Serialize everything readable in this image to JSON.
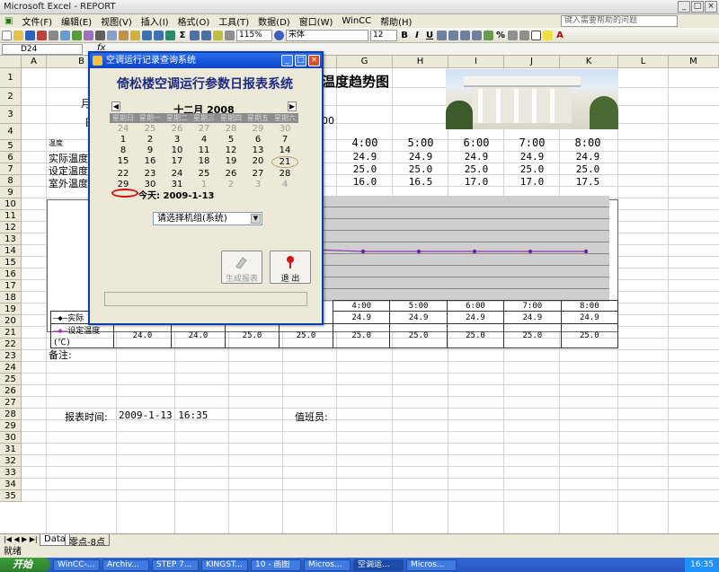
{
  "window": {
    "title": "Microsoft Excel - REPORT",
    "menu": [
      "文件(F)",
      "编辑(E)",
      "视图(V)",
      "插入(I)",
      "格式(O)",
      "工具(T)",
      "数据(D)",
      "窗口(W)",
      "WinCC",
      "帮助(H)"
    ],
    "help_placeholder": "键入需要帮助的问题",
    "zoom": "115%",
    "font": "宋体",
    "font_size": "12",
    "name_box": "D24",
    "fx": "fx"
  },
  "columns": [
    "A",
    "B",
    "C",
    "D",
    "E",
    "F",
    "G",
    "H",
    "I",
    "J",
    "K",
    "L",
    "M"
  ],
  "rows": [
    "1",
    "2",
    "3",
    "4",
    "5",
    "6",
    "7",
    "8",
    "9",
    "10",
    "11",
    "12",
    "13",
    "14",
    "15",
    "16",
    "17",
    "18",
    "19",
    "20",
    "21",
    "22",
    "23",
    "24",
    "25",
    "26",
    "27",
    "28",
    "29",
    "30",
    "31",
    "32",
    "33",
    "34",
    "35"
  ],
  "sheet": {
    "title_fragment": "温度趋势图",
    "row2_fragment": "月",
    "row3_fragment": "日",
    "row3_tail": "00",
    "row4_label": "温度",
    "row_labels": [
      "实际温度",
      "设定温度",
      "室外温度"
    ],
    "times": [
      "4:00",
      "5:00",
      "6:00",
      "7:00",
      "8:00"
    ],
    "actual": [
      "24.9",
      "24.9",
      "24.9",
      "24.9",
      "24.9"
    ],
    "setpoint": [
      "25.0",
      "25.0",
      "25.0",
      "25.0",
      "25.0"
    ],
    "outdoor": [
      "16.0",
      "16.5",
      "17.0",
      "17.0",
      "17.5"
    ],
    "chart_table": {
      "legend_actual": "实际",
      "legend_set": "设定温度(℃)",
      "times": [
        "4:00",
        "5:00",
        "6:00",
        "7:00",
        "8:00"
      ],
      "actual": [
        "24.9",
        "24.9",
        "24.9",
        "24.9",
        "24.9"
      ],
      "set_left": [
        "24.0",
        "24.0",
        "25.0",
        "25.0"
      ],
      "set": [
        "25.0",
        "25.0",
        "25.0",
        "25.0",
        "25.0"
      ]
    },
    "remarks_label": "备注:",
    "report_time_label": "报表时间:",
    "report_time_value": "2009-1-13 16:35",
    "duty_label": "值班员:"
  },
  "tabs": [
    "Data",
    "零点-8点"
  ],
  "status": "就绪",
  "dialog": {
    "title": "空调运行记录查询系统",
    "heading": "倚松楼空调运行参数日报表系统",
    "calendar": {
      "month": "十二月 2008",
      "weekdays": [
        "星期日",
        "星期一",
        "星期二",
        "星期三",
        "星期四",
        "星期五",
        "星期六"
      ],
      "days": [
        "24",
        "25",
        "26",
        "27",
        "28",
        "29",
        "30",
        "1",
        "2",
        "3",
        "4",
        "5",
        "6",
        "7",
        "8",
        "9",
        "10",
        "11",
        "12",
        "13",
        "14",
        "15",
        "16",
        "17",
        "18",
        "19",
        "20",
        "21",
        "22",
        "23",
        "24",
        "25",
        "26",
        "27",
        "28",
        "29",
        "30",
        "31",
        "1",
        "2",
        "3",
        "4"
      ],
      "today_label": "今天:",
      "today_value": "2009-1-13"
    },
    "combo_value": "请选择机组(系统)",
    "generate_label": "生成报表",
    "exit_label": "退 出"
  },
  "taskbar": {
    "start": "开始",
    "tasks": [
      "WinCC-...",
      "Archiv...",
      "STEP 7...",
      "KINGST...",
      "10 - 画图",
      "Micros...",
      "空调运...",
      "Micros..."
    ],
    "clock": "16:35"
  }
}
